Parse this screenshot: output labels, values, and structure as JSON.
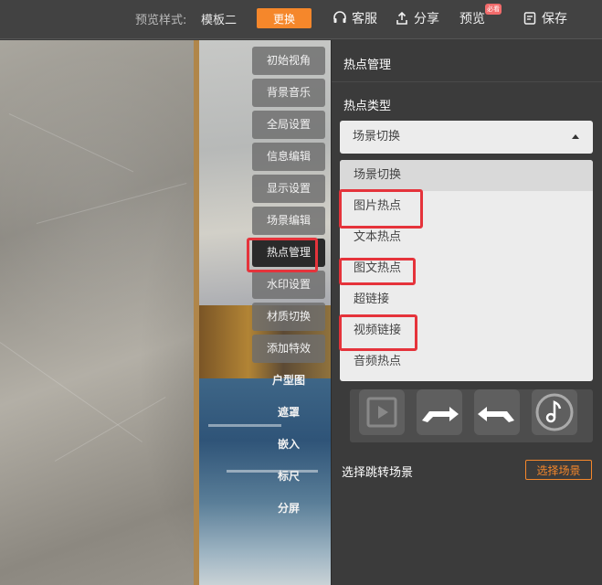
{
  "topbar": {
    "preview_style_label": "预览样式:",
    "template_name": "模板二",
    "change_button": "更换",
    "service": "客服",
    "share": "分享",
    "preview": "预览",
    "preview_badge": "必看",
    "save": "保存"
  },
  "side_menu": {
    "items": [
      {
        "label": "初始视角"
      },
      {
        "label": "背景音乐"
      },
      {
        "label": "全局设置"
      },
      {
        "label": "信息编辑"
      },
      {
        "label": "显示设置"
      },
      {
        "label": "场景编辑"
      },
      {
        "label": "热点管理",
        "active": true
      },
      {
        "label": "水印设置"
      },
      {
        "label": "材质切换"
      },
      {
        "label": "添加特效"
      },
      {
        "label": "户型图"
      },
      {
        "label": "遮罩"
      },
      {
        "label": "嵌入"
      },
      {
        "label": "标尺"
      },
      {
        "label": "分屏"
      }
    ]
  },
  "panel": {
    "title": "热点管理",
    "hotspot_type_label": "热点类型",
    "selected_type": "场景切换",
    "dropdown_options": [
      "场景切换",
      "图片热点",
      "文本热点",
      "图文热点",
      "超链接",
      "视频链接",
      "音频热点"
    ],
    "jump_scene_label": "选择跳转场景",
    "select_scene_button": "选择场景"
  },
  "colors": {
    "accent": "#f5872b",
    "highlight_box": "#e5333b",
    "topbar_bg": "#424242",
    "panel_bg": "#3b3b3b"
  },
  "icons": [
    "headset-icon",
    "share-icon",
    "eye-icon",
    "save-icon",
    "play-icon",
    "turn-right-arrow-icon",
    "turn-left-arrow-icon",
    "music-note-icon"
  ]
}
